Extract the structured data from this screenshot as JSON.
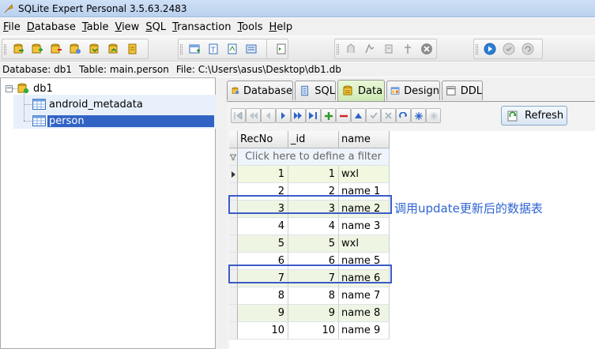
{
  "window": {
    "title": "SQLite Expert Personal 3.5.63.2483"
  },
  "menu": [
    {
      "label": "File",
      "ul": "F",
      "rest": "ile"
    },
    {
      "label": "Database",
      "ul": "D",
      "rest": "atabase"
    },
    {
      "label": "Table",
      "ul": "T",
      "rest": "able"
    },
    {
      "label": "View",
      "ul": "V",
      "rest": "iew"
    },
    {
      "label": "SQL",
      "ul": "S",
      "rest": "QL"
    },
    {
      "label": "Transaction",
      "ul": "T",
      "rest": "ransaction"
    },
    {
      "label": "Tools",
      "ul": "T",
      "rest": "ools"
    },
    {
      "label": "Help",
      "ul": "H",
      "rest": "elp"
    }
  ],
  "status": {
    "database": "Database: db1",
    "table": "Table: main.person",
    "file": "File: C:\\Users\\asus\\Desktop\\db1.db"
  },
  "tree": {
    "root": "db1",
    "expander": "−",
    "items": [
      {
        "label": "android_metadata"
      },
      {
        "label": "person"
      }
    ]
  },
  "tabs": [
    {
      "label": "Database"
    },
    {
      "label": "SQL"
    },
    {
      "label": "Data"
    },
    {
      "label": "Design"
    },
    {
      "label": "DDL"
    }
  ],
  "refresh_label": "Refresh",
  "grid": {
    "columns": [
      "RecNo",
      "_id",
      "name"
    ],
    "filter_placeholder": "Click here to define a filter",
    "rows": [
      {
        "recno": "1",
        "id": "1",
        "name": "wxl"
      },
      {
        "recno": "2",
        "id": "2",
        "name": "name 1"
      },
      {
        "recno": "3",
        "id": "3",
        "name": "name 2"
      },
      {
        "recno": "4",
        "id": "4",
        "name": "name 3"
      },
      {
        "recno": "5",
        "id": "5",
        "name": "wxl"
      },
      {
        "recno": "6",
        "id": "6",
        "name": "name 5"
      },
      {
        "recno": "7",
        "id": "7",
        "name": "name 6"
      },
      {
        "recno": "8",
        "id": "8",
        "name": "name 7"
      },
      {
        "recno": "9",
        "id": "9",
        "name": "name 8"
      },
      {
        "recno": "10",
        "id": "10",
        "name": "name 9"
      }
    ]
  },
  "annotation": "调用update更新后的数据表",
  "colors": {
    "selection": "#3163c4",
    "highlight_box": "#3a5bc7",
    "annotation": "#2f64d2",
    "active_tab": "#cfeab5"
  }
}
